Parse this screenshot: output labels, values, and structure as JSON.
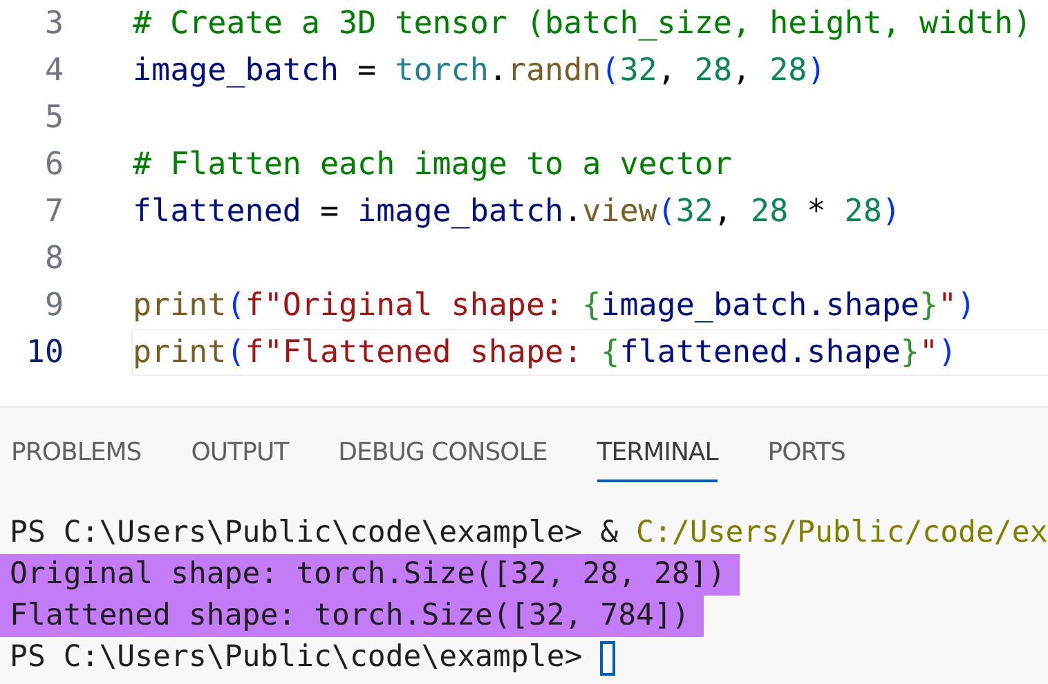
{
  "editor": {
    "lines": [
      {
        "number": "3",
        "current": false,
        "tokens": [
          {
            "kind": "comment",
            "text": "# Create a 3D tensor (batch_size, height, width)"
          }
        ]
      },
      {
        "number": "4",
        "current": false,
        "tokens": [
          {
            "kind": "variable",
            "text": "image_batch"
          },
          {
            "kind": "operator",
            "text": " = "
          },
          {
            "kind": "module",
            "text": "torch"
          },
          {
            "kind": "operator",
            "text": "."
          },
          {
            "kind": "function",
            "text": "randn"
          },
          {
            "kind": "paren",
            "text": "("
          },
          {
            "kind": "number",
            "text": "32"
          },
          {
            "kind": "operator",
            "text": ", "
          },
          {
            "kind": "number",
            "text": "28"
          },
          {
            "kind": "operator",
            "text": ", "
          },
          {
            "kind": "number",
            "text": "28"
          },
          {
            "kind": "paren",
            "text": ")"
          }
        ]
      },
      {
        "number": "5",
        "current": false
      },
      {
        "number": "6",
        "current": false,
        "tokens": [
          {
            "kind": "comment",
            "text": "# Flatten each image to a vector"
          }
        ]
      },
      {
        "number": "7",
        "current": false,
        "tokens": [
          {
            "kind": "variable",
            "text": "flattened"
          },
          {
            "kind": "operator",
            "text": " = "
          },
          {
            "kind": "variable",
            "text": "image_batch"
          },
          {
            "kind": "operator",
            "text": "."
          },
          {
            "kind": "function",
            "text": "view"
          },
          {
            "kind": "paren",
            "text": "("
          },
          {
            "kind": "number",
            "text": "32"
          },
          {
            "kind": "operator",
            "text": ", "
          },
          {
            "kind": "number",
            "text": "28"
          },
          {
            "kind": "operator",
            "text": " * "
          },
          {
            "kind": "number",
            "text": "28"
          },
          {
            "kind": "paren",
            "text": ")"
          }
        ]
      },
      {
        "number": "8",
        "current": false
      },
      {
        "number": "9",
        "current": false,
        "tokens": [
          {
            "kind": "function",
            "text": "print"
          },
          {
            "kind": "paren",
            "text": "("
          },
          {
            "kind": "string",
            "text": "f\"Original shape: "
          },
          {
            "kind": "brace",
            "text": "{"
          },
          {
            "kind": "variable",
            "text": "image_batch.shape"
          },
          {
            "kind": "brace",
            "text": "}"
          },
          {
            "kind": "string",
            "text": "\""
          },
          {
            "kind": "paren",
            "text": ")"
          }
        ]
      },
      {
        "number": "10",
        "current": true,
        "tokens": [
          {
            "kind": "function",
            "text": "print"
          },
          {
            "kind": "paren",
            "text": "("
          },
          {
            "kind": "string",
            "text": "f\"Flattened shape: "
          },
          {
            "kind": "brace",
            "text": "{"
          },
          {
            "kind": "variable",
            "text": "flattened.shape"
          },
          {
            "kind": "brace",
            "text": "}"
          },
          {
            "kind": "string",
            "text": "\""
          },
          {
            "kind": "paren",
            "text": ")"
          }
        ]
      }
    ]
  },
  "panel": {
    "tabs": [
      {
        "label": "PROBLEMS",
        "selected": false
      },
      {
        "label": "OUTPUT",
        "selected": false
      },
      {
        "label": "DEBUG CONSOLE",
        "selected": false
      },
      {
        "label": "TERMINAL",
        "selected": true
      },
      {
        "label": "PORTS",
        "selected": false
      }
    ]
  },
  "terminal": {
    "lines": [
      {
        "highlighted": false,
        "cursor": false,
        "segments": [
          {
            "kind": "plain",
            "text": "PS C:\\Users\\Public\\code\\example> & "
          },
          {
            "kind": "path",
            "text": "C:/Users/Public/code/ex"
          }
        ]
      },
      {
        "highlighted": true,
        "cursor": false,
        "segments": [
          {
            "kind": "plain",
            "text": "Original shape: torch.Size([32, 28, 28])"
          }
        ]
      },
      {
        "highlighted": true,
        "cursor": false,
        "segments": [
          {
            "kind": "plain",
            "text": "Flattened shape: torch.Size([32, 784])"
          }
        ]
      },
      {
        "highlighted": false,
        "cursor": true,
        "segments": [
          {
            "kind": "plain",
            "text": "PS C:\\Users\\Public\\code\\example> "
          }
        ]
      }
    ]
  }
}
